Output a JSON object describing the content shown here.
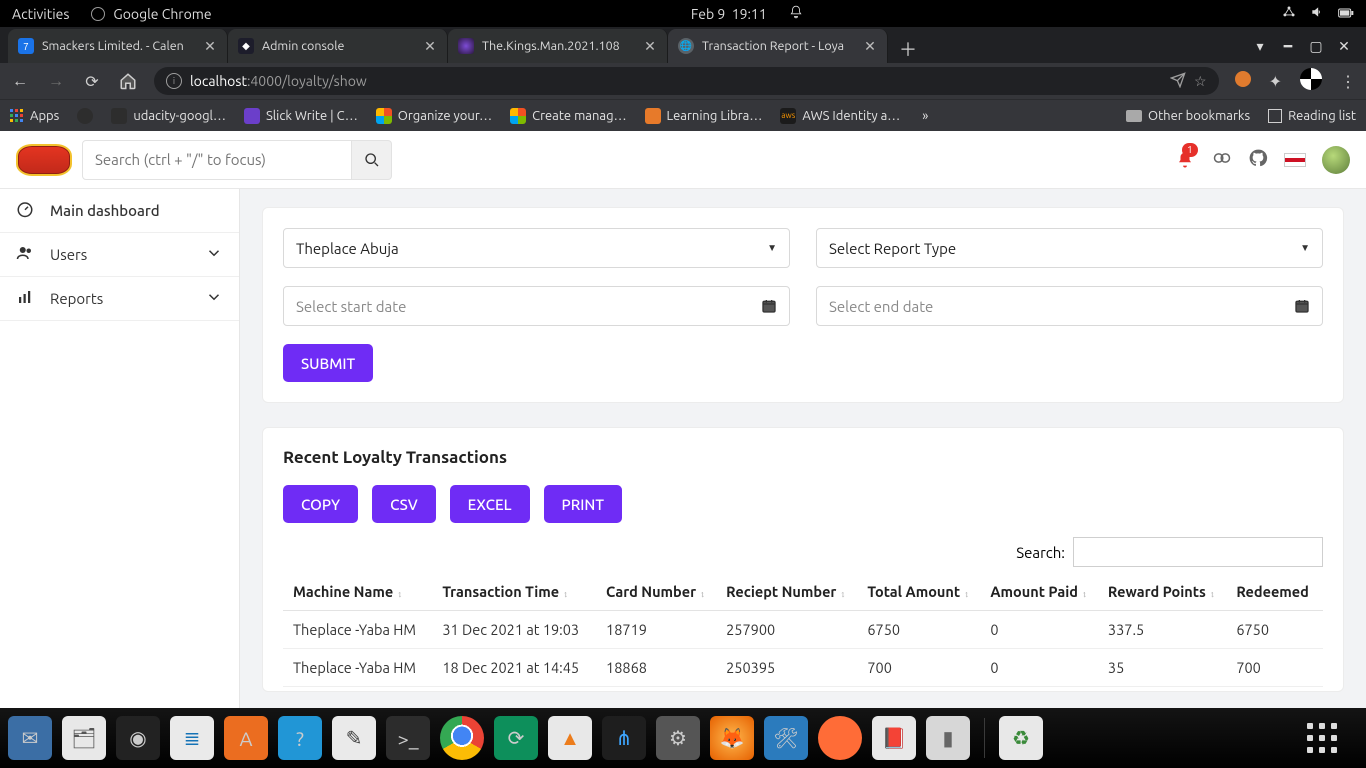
{
  "gnome": {
    "activities": "Activities",
    "app": "Google Chrome",
    "date": "Feb 9",
    "time": "19:11"
  },
  "chrome": {
    "tabs": [
      {
        "label": "Smackers Limited. - Calen"
      },
      {
        "label": "Admin console"
      },
      {
        "label": "The.Kings.Man.2021.108"
      },
      {
        "label": "Transaction Report - Loya"
      }
    ],
    "url_host": "localhost",
    "url_path": ":4000/loyalty/show",
    "bookmarks": [
      {
        "label": "Apps"
      },
      {
        "label": ""
      },
      {
        "label": "udacity-googl…"
      },
      {
        "label": "Slick Write | C…"
      },
      {
        "label": "Organize your…"
      },
      {
        "label": "Create manag…"
      },
      {
        "label": "Learning Libra…"
      },
      {
        "label": "AWS Identity a…"
      }
    ],
    "more": "»",
    "right_bookmarks": [
      {
        "label": "Other bookmarks"
      },
      {
        "label": "Reading list"
      }
    ]
  },
  "app": {
    "search_placeholder": "Search (ctrl + \"/\" to focus)",
    "notif_count": "1",
    "sidebar": {
      "items": [
        {
          "label": "Main dashboard"
        },
        {
          "label": "Users"
        },
        {
          "label": "Reports"
        }
      ]
    },
    "filters": {
      "location": "Theplace Abuja",
      "report_type": "Select Report Type",
      "start_date": "Select start date",
      "end_date": "Select end date",
      "submit": "SUBMIT"
    },
    "section_title": "Recent Loyalty Transactions",
    "exports": {
      "copy": "COPY",
      "csv": "CSV",
      "excel": "EXCEL",
      "print": "PRINT"
    },
    "search_label": "Search:",
    "columns": [
      "Machine Name",
      "Transaction Time",
      "Card Number",
      "Reciept Number",
      "Total Amount",
      "Amount Paid",
      "Reward Points",
      "Redeemed"
    ],
    "rows": [
      {
        "machine": "Theplace -Yaba HM",
        "time": "31 Dec 2021 at 19:03",
        "card": "18719",
        "receipt": "257900",
        "total": "6750",
        "paid": "0",
        "points": "337.5",
        "redeemed": "6750"
      },
      {
        "machine": "Theplace -Yaba HM",
        "time": "18 Dec 2021 at 14:45",
        "card": "18868",
        "receipt": "250395",
        "total": "700",
        "paid": "0",
        "points": "35",
        "redeemed": "700"
      }
    ]
  }
}
